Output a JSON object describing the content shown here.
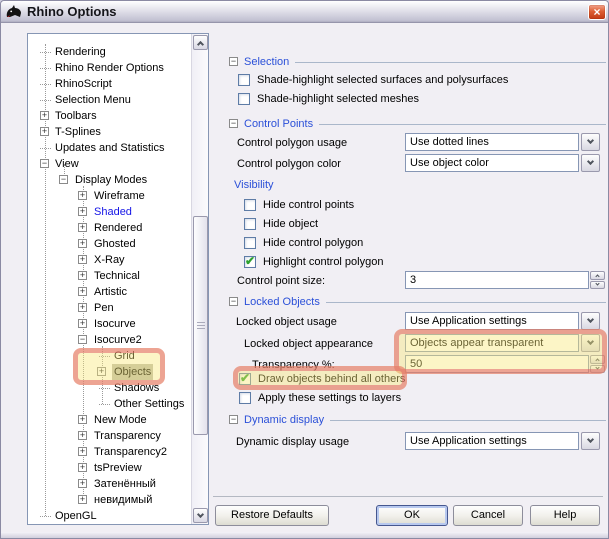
{
  "window": {
    "title": "Rhino Options",
    "close_glyph": "×"
  },
  "tree": {
    "items": [
      {
        "label": "Rendering",
        "level": 0,
        "glyph": ""
      },
      {
        "label": "Rhino Render Options",
        "level": 0,
        "glyph": ""
      },
      {
        "label": "RhinoScript",
        "level": 0,
        "glyph": ""
      },
      {
        "label": "Selection Menu",
        "level": 0,
        "glyph": ""
      },
      {
        "label": "Toolbars",
        "level": 0,
        "glyph": "+"
      },
      {
        "label": "T-Splines",
        "level": 0,
        "glyph": "+"
      },
      {
        "label": "Updates and Statistics",
        "level": 0,
        "glyph": ""
      },
      {
        "label": "View",
        "level": 0,
        "glyph": "-"
      },
      {
        "label": "Display Modes",
        "level": 1,
        "glyph": "-"
      },
      {
        "label": "Wireframe",
        "level": 2,
        "glyph": "+"
      },
      {
        "label": "Shaded",
        "level": 2,
        "glyph": "+",
        "blue": true
      },
      {
        "label": "Rendered",
        "level": 2,
        "glyph": "+"
      },
      {
        "label": "Ghosted",
        "level": 2,
        "glyph": "+"
      },
      {
        "label": "X-Ray",
        "level": 2,
        "glyph": "+"
      },
      {
        "label": "Technical",
        "level": 2,
        "glyph": "+"
      },
      {
        "label": "Artistic",
        "level": 2,
        "glyph": "+"
      },
      {
        "label": "Pen",
        "level": 2,
        "glyph": "+"
      },
      {
        "label": "Isocurve",
        "level": 2,
        "glyph": "+"
      },
      {
        "label": "Isocurve2",
        "level": 2,
        "glyph": "-"
      },
      {
        "label": "Grid",
        "level": 3,
        "glyph": ""
      },
      {
        "label": "Objects",
        "level": 3,
        "glyph": "+",
        "selected": true
      },
      {
        "label": "Shadows",
        "level": 3,
        "glyph": ""
      },
      {
        "label": "Other Settings",
        "level": 3,
        "glyph": ""
      },
      {
        "label": "New Mode",
        "level": 2,
        "glyph": "+"
      },
      {
        "label": "Transparency",
        "level": 2,
        "glyph": "+"
      },
      {
        "label": "Transparency2",
        "level": 2,
        "glyph": "+"
      },
      {
        "label": "tsPreview",
        "level": 2,
        "glyph": "+"
      },
      {
        "label": "Затенённый",
        "level": 2,
        "glyph": "+"
      },
      {
        "label": "невидимый",
        "level": 2,
        "glyph": "+"
      },
      {
        "label": "OpenGL",
        "level": 0,
        "glyph": ""
      }
    ]
  },
  "panel": {
    "selection": {
      "title": "Selection",
      "cb1": {
        "label": "Shade-highlight selected surfaces and polysurfaces",
        "checked": false
      },
      "cb2": {
        "label": "Shade-highlight selected meshes",
        "checked": false
      }
    },
    "control_points": {
      "title": "Control Points",
      "usage": {
        "label": "Control polygon usage",
        "value": "Use dotted lines"
      },
      "color": {
        "label": "Control polygon color",
        "value": "Use object color"
      },
      "visibility_title": "Visibility",
      "cb1": {
        "label": "Hide control points",
        "checked": false
      },
      "cb2": {
        "label": "Hide object",
        "checked": false
      },
      "cb3": {
        "label": "Hide control polygon",
        "checked": false
      },
      "cb4": {
        "label": "Highlight control polygon",
        "checked": true
      },
      "size": {
        "label": "Control point size:",
        "value": "3"
      }
    },
    "locked_objects": {
      "title": "Locked Objects",
      "usage": {
        "label": "Locked object usage",
        "value": "Use Application settings"
      },
      "appearance": {
        "label": "Locked object appearance",
        "value": "Objects appear transparent"
      },
      "transparency": {
        "label": "Transparency %:",
        "value": "50"
      },
      "cb1": {
        "label": "Draw objects behind all others",
        "checked": true
      },
      "cb2": {
        "label": "Apply these settings to layers",
        "checked": false
      }
    },
    "dynamic_display": {
      "title": "Dynamic display",
      "usage": {
        "label": "Dynamic display usage",
        "value": "Use Application settings"
      }
    }
  },
  "footer": {
    "restore_label": "Restore Defaults",
    "ok_label": "OK",
    "cancel_label": "Cancel",
    "help_label": "Help"
  },
  "colors": {
    "annotation_border": "rgba(222,84,96,0.5)",
    "annotation_fill": "rgba(247,230,120,0.42)",
    "section_header_blue": "#2b50d8",
    "tree_modified_blue": "#1414e6",
    "check_green": "#2da12d",
    "selected_item_bg": "#bcbcb0"
  }
}
